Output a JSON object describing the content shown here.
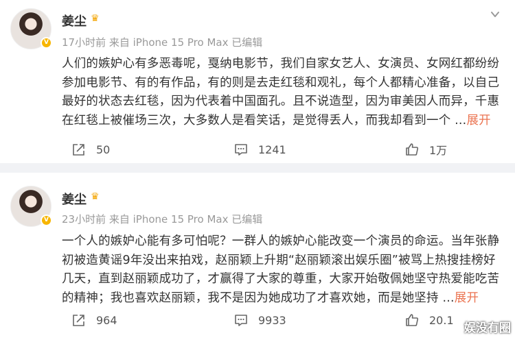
{
  "posts": [
    {
      "author": "姜尘",
      "meta": "17小时前 来自 iPhone 15 Pro Max 已编辑",
      "lines": [
        "人们的嫉妒心有多恶毒呢，戛纳电影节，我们自家女艺人、女演员、女网红都纷纷",
        "参加电影节、有的有作品，有的则是去走红毯和观礼，每个人都精心准备，以自己",
        "最好的状态去红毯，因为代表着中国面孔。且不说造型，因为审美因人而异，千惠",
        "在红毯上被催场三次，大多数人是看笑话，是觉得丢人，而我却看到一个 ..."
      ],
      "expand": "展开",
      "reposts": "50",
      "comments": "1241",
      "likes": "1万"
    },
    {
      "author": "姜尘",
      "meta": "23小时前 来自 iPhone 15 Pro Max 已编辑",
      "lines": [
        "一个人的嫉妒心能有多可怕呢？一群人的嫉妒心能改变一个演员的命运。当年张静",
        "初被造黄谣9年没出来拍戏，赵丽颖上升期“赵丽颖滚出娱乐圈”被骂上热搜挂榜好",
        "几天，直到赵丽颖成功了，才赢得了大家的尊重，大家开始敬佩她坚守热爱能吃苦",
        "的精神；我也喜欢赵丽颖，我不是因为她成功了才喜欢她，而是她坚持 ..."
      ],
      "expand": "展开",
      "reposts": "964",
      "comments": "9933",
      "likes": "20.1"
    }
  ],
  "watermark": "娱没有圈",
  "colors": {
    "expand": "#eb7350",
    "meta": "#999999",
    "badge": "#f7b500",
    "divider": "#f1f2f5"
  },
  "icons": [
    "repost-icon",
    "comment-icon",
    "like-icon",
    "chevron-down-icon",
    "verified-badge-icon"
  ]
}
